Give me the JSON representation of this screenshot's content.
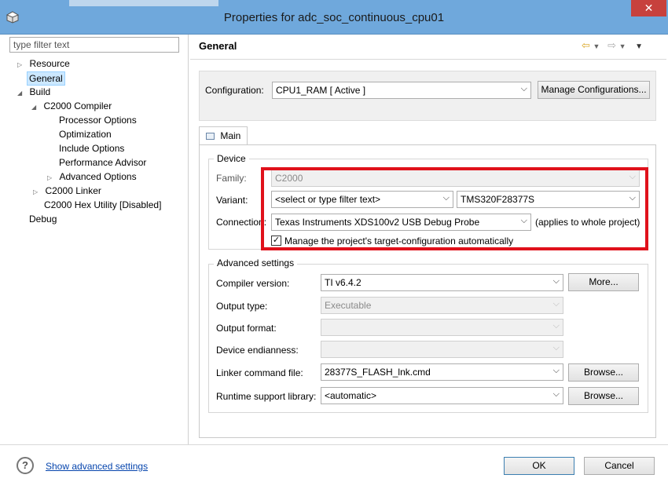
{
  "window": {
    "title": "Properties for adc_soc_continuous_cpu01",
    "close_glyph": "✕"
  },
  "filter": {
    "placeholder": "type filter text"
  },
  "tree": {
    "resource": "Resource",
    "general": "General",
    "build": "Build",
    "compiler": "C2000 Compiler",
    "processor_options": "Processor Options",
    "optimization": "Optimization",
    "include_options": "Include Options",
    "performance_advisor": "Performance Advisor",
    "advanced_options": "Advanced Options",
    "linker": "C2000 Linker",
    "hex_utility": "C2000 Hex Utility  [Disabled]",
    "debug": "Debug"
  },
  "header": {
    "title": "General"
  },
  "configuration": {
    "label": "Configuration:",
    "value": "CPU1_RAM  [ Active ]",
    "manage_button": "Manage Configurations..."
  },
  "tabs": {
    "main": "Main"
  },
  "device": {
    "group_title": "Device",
    "family_label": "Family:",
    "family_value": "C2000",
    "variant_label": "Variant:",
    "variant_filter": "<select or type filter text>",
    "variant_value": "TMS320F28377S",
    "connection_label": "Connection:",
    "connection_value": "Texas Instruments XDS100v2 USB Debug Probe",
    "connection_note": "(applies to whole project)",
    "manage_target_label": "Manage the project's target-configuration automatically",
    "manage_target_checked": true
  },
  "advanced": {
    "group_title": "Advanced settings",
    "compiler_label": "Compiler version:",
    "compiler_value": "TI v6.4.2",
    "more_button": "More...",
    "output_type_label": "Output type:",
    "output_type_value": "Executable",
    "output_format_label": "Output format:",
    "output_format_value": "",
    "endianness_label": "Device endianness:",
    "endianness_value": "",
    "linker_cmd_label": "Linker command file:",
    "linker_cmd_value": "28377S_FLASH_lnk.cmd",
    "browse_button_1": "Browse...",
    "runtime_label": "Runtime support library:",
    "runtime_value": "<automatic>",
    "browse_button_2": "Browse..."
  },
  "footer": {
    "help_glyph": "?",
    "advanced_link": "Show advanced settings",
    "ok_button": "OK",
    "cancel_button": "Cancel"
  },
  "colors": {
    "titlebar": "#6fa8dc",
    "close": "#c7413d",
    "highlight_box": "#e0111b",
    "selection": "#cce8ff"
  }
}
